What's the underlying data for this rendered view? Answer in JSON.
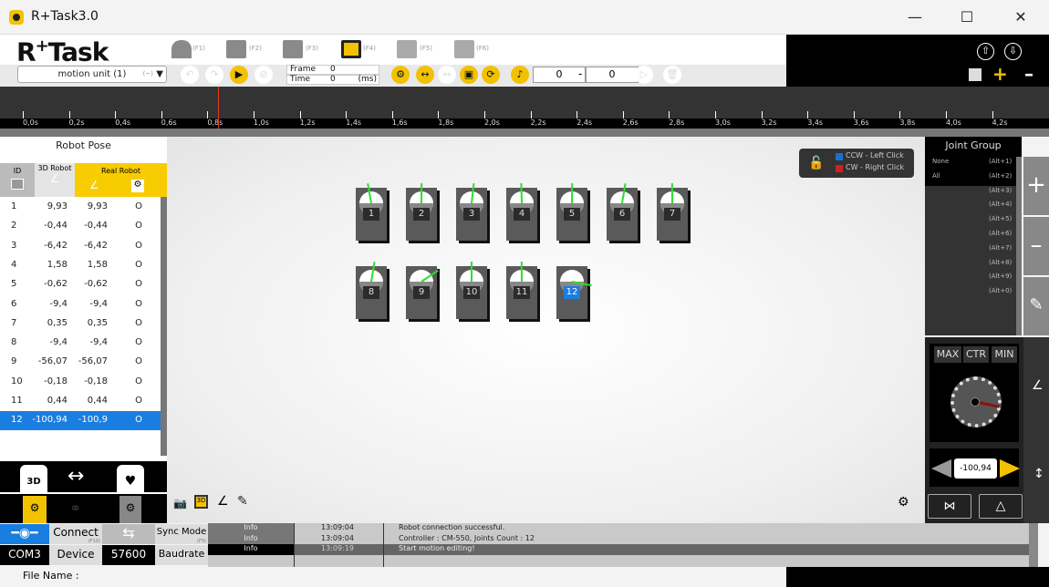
{
  "window": {
    "title": "R+Task3.0",
    "controls": [
      "minimize",
      "maximize",
      "close"
    ]
  },
  "header": {
    "logo_r": "R",
    "logo_plus": "+",
    "logo_task": "Task",
    "nav": [
      {
        "icon": "home-icon",
        "key": "(F1)"
      },
      {
        "icon": "code-monitor-icon",
        "key": "(F2)"
      },
      {
        "icon": "alert-monitor-icon",
        "key": "(F3)"
      },
      {
        "icon": "film-icon",
        "key": "(F4)"
      },
      {
        "icon": "clapper-icon",
        "key": "(F5)"
      },
      {
        "icon": "download-icon",
        "key": "(F6)"
      }
    ]
  },
  "toolbar": {
    "motion_unit": "motion unit (1)",
    "motion_unit_hint": "(~)",
    "frame_label": "Frame",
    "frame_value": "0",
    "time_label": "Time",
    "time_value": "0",
    "time_unit": "(ms)",
    "range_start": "0",
    "range_dash": "-",
    "range_end": "0"
  },
  "timeline": {
    "labels": [
      "0,0s",
      "0,2s",
      "0,4s",
      "0,6s",
      "0,8s",
      "1,0s",
      "1,2s",
      "1,4s",
      "1,6s",
      "1,8s",
      "2,0s",
      "2,2s",
      "2,4s",
      "2,6s",
      "2,8s",
      "3,0s",
      "3,2s",
      "3,4s",
      "3,6s",
      "3,8s",
      "4,0s",
      "4,2s"
    ]
  },
  "robot_pose": {
    "title": "Robot Pose",
    "headers": {
      "id": "ID",
      "robot3d": "3D Robot",
      "real": "Real Robot"
    },
    "rows": [
      {
        "id": "1",
        "v3d": "9,93",
        "real": "9,93",
        "torque": "O"
      },
      {
        "id": "2",
        "v3d": "-0,44",
        "real": "-0,44",
        "torque": "O"
      },
      {
        "id": "3",
        "v3d": "-6,42",
        "real": "-6,42",
        "torque": "O"
      },
      {
        "id": "4",
        "v3d": "1,58",
        "real": "1,58",
        "torque": "O"
      },
      {
        "id": "5",
        "v3d": "-0,62",
        "real": "-0,62",
        "torque": "O"
      },
      {
        "id": "6",
        "v3d": "-9,4",
        "real": "-9,4",
        "torque": "O"
      },
      {
        "id": "7",
        "v3d": "0,35",
        "real": "0,35",
        "torque": "O"
      },
      {
        "id": "8",
        "v3d": "-9,4",
        "real": "-9,4",
        "torque": "O"
      },
      {
        "id": "9",
        "v3d": "-56,07",
        "real": "-56,07",
        "torque": "O"
      },
      {
        "id": "10",
        "v3d": "-0,18",
        "real": "-0,18",
        "torque": "O"
      },
      {
        "id": "11",
        "v3d": "0,44",
        "real": "0,44",
        "torque": "O"
      },
      {
        "id": "12",
        "v3d": "-100,94",
        "real": "-100,9",
        "torque": "O",
        "selected": true
      }
    ]
  },
  "servos": [
    {
      "id": "1",
      "angle": 9.93
    },
    {
      "id": "2",
      "angle": -0.44
    },
    {
      "id": "3",
      "angle": -6.42
    },
    {
      "id": "4",
      "angle": 1.58
    },
    {
      "id": "5",
      "angle": -0.62
    },
    {
      "id": "6",
      "angle": -9.4
    },
    {
      "id": "7",
      "angle": 0.35
    },
    {
      "id": "8",
      "angle": -9.4
    },
    {
      "id": "9",
      "angle": -56.07
    },
    {
      "id": "10",
      "angle": -0.18
    },
    {
      "id": "11",
      "angle": 0.44
    },
    {
      "id": "12",
      "angle": -100.94,
      "selected": true
    }
  ],
  "lock_panel": {
    "ccw": "CCW  - Left Click",
    "cw": "CW    - Right Click",
    "ccw_color": "#1a6fd0",
    "cw_color": "#d02020"
  },
  "joint_group": {
    "title": "Joint Group",
    "items": [
      {
        "name": "None",
        "key": "(Alt+1)"
      },
      {
        "name": "All",
        "key": "(Alt+2)"
      },
      {
        "name": "",
        "key": "(Alt+3)"
      },
      {
        "name": "",
        "key": "(Alt+4)"
      },
      {
        "name": "",
        "key": "(Alt+5)"
      },
      {
        "name": "",
        "key": "(Alt+6)"
      },
      {
        "name": "",
        "key": "(Alt+7)"
      },
      {
        "name": "",
        "key": "(Alt+8)"
      },
      {
        "name": "",
        "key": "(Alt+9)"
      },
      {
        "name": "",
        "key": "(Alt+0)"
      }
    ]
  },
  "dial": {
    "max": "MAX",
    "ctr": "CTR",
    "min": "MIN",
    "value": "-100,94"
  },
  "connection": {
    "connect": "Connect",
    "connect_key": "(F10)",
    "sync": "Sync Mode",
    "sync_key": "(F9)",
    "port": "COM3",
    "device": "Device",
    "baud": "57600",
    "baud_label": "Baudrate"
  },
  "log": [
    {
      "level": "Info",
      "time": "13:09:04",
      "msg": "Robot connection successful."
    },
    {
      "level": "Info",
      "time": "13:09:04",
      "msg": "Controller : CM-550, Joints Count : 12"
    },
    {
      "level": "Info",
      "time": "13:09:19",
      "msg": "Start motion editing!"
    }
  ],
  "file_name_label": "File Name :",
  "accent": "#f2c200",
  "selection": "#1a7de0"
}
